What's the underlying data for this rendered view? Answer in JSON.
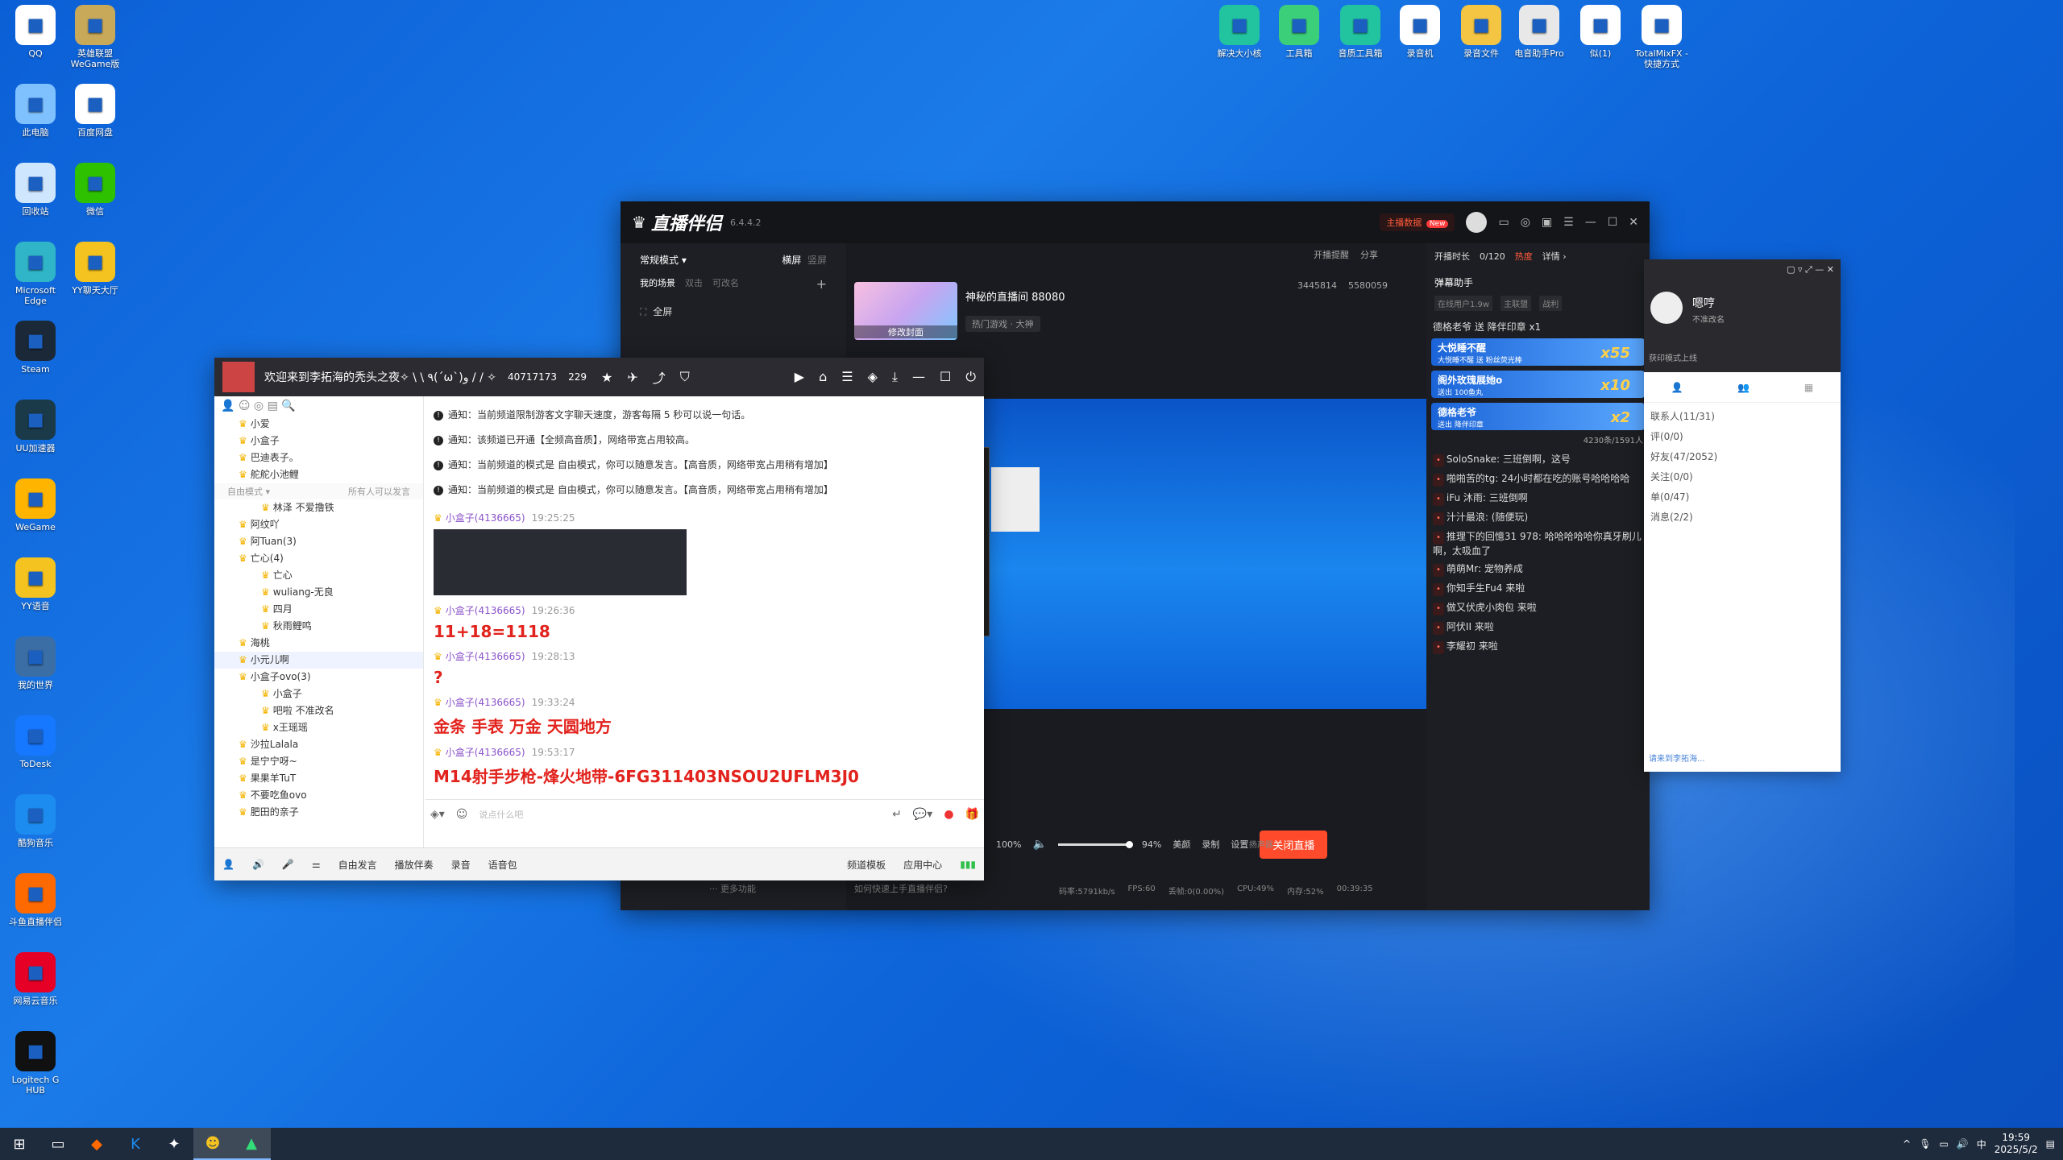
{
  "desktop_icons": [
    {
      "label": "QQ",
      "icon": "qq-penguin-icon",
      "color": "#ffffff"
    },
    {
      "label": "英雄联盟WeGame版",
      "icon": "lol-icon",
      "color": "#c8a95a"
    },
    {
      "label": "此电脑",
      "icon": "computer-icon",
      "color": "#7fc1ff"
    },
    {
      "label": "百度网盘",
      "icon": "file-icon",
      "color": "#ffffff"
    },
    {
      "label": "回收站",
      "icon": "recycle-bin-icon",
      "color": "#cfe6ff"
    },
    {
      "label": "微信",
      "icon": "wechat-icon",
      "color": "#2dc100"
    },
    {
      "label": "Microsoft Edge",
      "icon": "edge-icon",
      "color": "#2fb5c7"
    },
    {
      "label": "YY聊天大厅",
      "icon": "yy-icon",
      "color": "#f5c320"
    },
    {
      "label": "Steam",
      "icon": "steam-icon",
      "color": "#1b2838"
    },
    {
      "label": "UU加速器",
      "icon": "uu-icon",
      "color": "#1a3a4a"
    },
    {
      "label": "WeGame",
      "icon": "wegame-icon",
      "color": "#ffb400"
    },
    {
      "label": "YY语音",
      "icon": "yy-voice-icon",
      "color": "#f5c320"
    },
    {
      "label": "我的世界",
      "icon": "minecraft-icon",
      "color": "#3b6ea5"
    },
    {
      "label": "ToDesk",
      "icon": "todesk-icon",
      "color": "#1677ff"
    },
    {
      "label": "酷狗音乐",
      "icon": "kugou-icon",
      "color": "#1d8cf0"
    },
    {
      "label": "斗鱼直播伴侣",
      "icon": "douyu-icon",
      "color": "#ff6a00"
    },
    {
      "label": "网易云音乐",
      "icon": "netease-music-icon",
      "color": "#e60026"
    },
    {
      "label": "Logitech G HUB",
      "icon": "logitech-icon",
      "color": "#111111"
    }
  ],
  "top_icons": [
    {
      "label": "解决大小核",
      "icon": "app-icon",
      "color": "#22c4a0"
    },
    {
      "label": "工具箱",
      "icon": "toolbox-icon",
      "color": "#3ccf7a"
    },
    {
      "label": "音质工具箱",
      "icon": "audio-tool-icon",
      "color": "#22c4a0"
    },
    {
      "label": "录音机",
      "icon": "recorder-icon",
      "color": "#ffffff"
    },
    {
      "label": "录音文件",
      "icon": "folder-icon",
      "color": "#f4c542"
    },
    {
      "label": "电音助手Pro",
      "icon": "cd-icon",
      "color": "#e8e8e8"
    },
    {
      "label": "似(1)",
      "icon": "doc-icon",
      "color": "#ffffff"
    },
    {
      "label": "TotalMixFX - 快捷方式",
      "icon": "totalmix-icon",
      "color": "#ffffff"
    }
  ],
  "zb": {
    "logo": "直播伴侣",
    "version": "6.4.4.2",
    "badge_label": "主播数据",
    "badge_new": "New",
    "mode": "常规模式 ▾",
    "orient_h": "横屏",
    "orient_v": "竖屏",
    "tab_scenes": "我的场景",
    "tab_dual": "双击",
    "tab_rename": "可改名",
    "scene_full": "全屏",
    "cover_label": "修改封面",
    "room_title": "神秘的直播间 88080",
    "category": "热门游戏 · 大神",
    "remind": "开播提醒",
    "share": "分享",
    "stat_a": "3445814",
    "stat_b": "5580059",
    "volume_left": "100%",
    "volume_right": "94%",
    "mic_label": "扬声器",
    "beauty": "美颜",
    "record": "录制",
    "settings": "设置",
    "stop_btn": "关闭直播",
    "more": "··· 更多功能",
    "hint": "如何快速上手直播伴侣?",
    "status": [
      "码率:5791kb/s",
      "FPS:60",
      "丢帧:0(0.00%)",
      "CPU:49%",
      "内存:52%",
      "00:39:35"
    ],
    "duration_label": "开播时长",
    "quota": "0/120",
    "hot": "热度",
    "detail": "详情 ›",
    "danmu_title": "弹幕助手",
    "filter_a": "在线用户1.9w",
    "filter_b": "主联盟",
    "filter_c": "战利",
    "online_counter": "4230条/1591人",
    "danmu": [
      "德格老爷 送 降伴印章 x1",
      "SoloSnake: 三班倒啊，这号",
      "啪啪苦的tg: 24小时都在吃的账号哈哈哈哈",
      "iFu 沐雨: 三班倒啊",
      "汁汁最浪: (随便玩)",
      "推理下的回憶31 978: 哈哈哈哈哈你真牙刷儿啊，太吸血了",
      "萌萌Mr: 宠物养成",
      "你知手生Fu4 来啦",
      "做又伏虎小肉包 来啦",
      "阿伏II 来啦",
      "李耀初 来啦"
    ],
    "gifts": [
      {
        "name": "大悦睡不醒",
        "sub": "大悦睡不醒 送 粉丝荧光棒",
        "count": "x55"
      },
      {
        "name": "阁外玫瑰展她o",
        "sub": "送出 100鱼丸",
        "count": "x10"
      },
      {
        "name": "德格老爷",
        "sub": "送出 降伴印章",
        "count": "x2"
      }
    ]
  },
  "qq": {
    "name": "嗯哼",
    "sign": "不准改名",
    "rows": [
      "联系人(11/31)",
      "评(0/0)",
      "好友(47/2052)",
      "关注(0/0)",
      "单(0/47)",
      "消息(2/2)"
    ],
    "mode_hint": "获印模式上线",
    "search_hint": "请来到李拓海..."
  },
  "yy": {
    "title": "欢迎来到李拓海的秃头之夜✧ \\ \\ ٩(ˊωˋ)و / / ✧",
    "room_id": "40717173",
    "online": "229",
    "free_mode": "自由模式 ▾",
    "free_hint": "所有人可以发言",
    "members": [
      {
        "name": "小爱",
        "cls": ""
      },
      {
        "name": "小盒子",
        "cls": ""
      },
      {
        "name": "巴迪表子。",
        "cls": ""
      },
      {
        "name": "舵舵小池鲤",
        "cls": ""
      },
      {
        "name": "林泽  不爱撸铁",
        "cls": "sub"
      },
      {
        "name": "阿纹吖",
        "cls": ""
      },
      {
        "name": "阿Tuan(3)",
        "cls": ""
      },
      {
        "name": "亡心(4)",
        "cls": ""
      },
      {
        "name": "亡心",
        "cls": "sub"
      },
      {
        "name": "wuliang-无良",
        "cls": "sub"
      },
      {
        "name": "四月",
        "cls": "sub"
      },
      {
        "name": "秋雨鲤鸣",
        "cls": "sub"
      },
      {
        "name": "海桃",
        "cls": ""
      },
      {
        "name": "小元儿啊",
        "cls": "hl"
      },
      {
        "name": "小盒子ovo(3)",
        "cls": ""
      },
      {
        "name": "小盒子",
        "cls": "sub"
      },
      {
        "name": "吧啦  不准改名",
        "cls": "sub"
      },
      {
        "name": "x王瑶瑶",
        "cls": "sub"
      },
      {
        "name": "沙拉Lalala",
        "cls": ""
      },
      {
        "name": "是宁宁呀~",
        "cls": ""
      },
      {
        "name": "果果羊TuT",
        "cls": ""
      },
      {
        "name": "不要吃鱼ovo",
        "cls": ""
      },
      {
        "name": "肥田的亲子",
        "cls": ""
      }
    ],
    "notices": [
      "通知：当前频道限制游客文字聊天速度，游客每隔 5 秒可以说一句话。",
      "通知：该频道已开通【全频高音质】，网络带宽占用较高。",
      "通知：当前频道的模式是 自由模式，你可以随意发言。【高音质，网络带宽占用稍有增加】",
      "通知：当前频道的模式是 自由模式，你可以随意发言。【高音质，网络带宽占用稍有增加】"
    ],
    "messages": [
      {
        "user": "小盒子(4136665)",
        "time": "19:25:25",
        "text": ""
      },
      {
        "user": "小盒子(4136665)",
        "time": "19:26:36",
        "text": "11+18=1118"
      },
      {
        "user": "小盒子(4136665)",
        "time": "19:28:13",
        "text": "?"
      },
      {
        "user": "小盒子(4136665)",
        "time": "19:33:24",
        "text": "金条 手表 万金 天圆地方"
      },
      {
        "user": "小盒子(4136665)",
        "time": "19:53:17",
        "text": "M14射手步枪-烽火地带-6FG311403NSOU2UFLM3J0"
      }
    ],
    "input_placeholder": "说点什么吧",
    "bottom": [
      "自由发言",
      "播放伴奏",
      "录音",
      "语音包",
      "频道模板",
      "应用中心"
    ]
  },
  "taskbar": {
    "time": "19:59",
    "date": "2025/5/2",
    "ime": "中"
  }
}
